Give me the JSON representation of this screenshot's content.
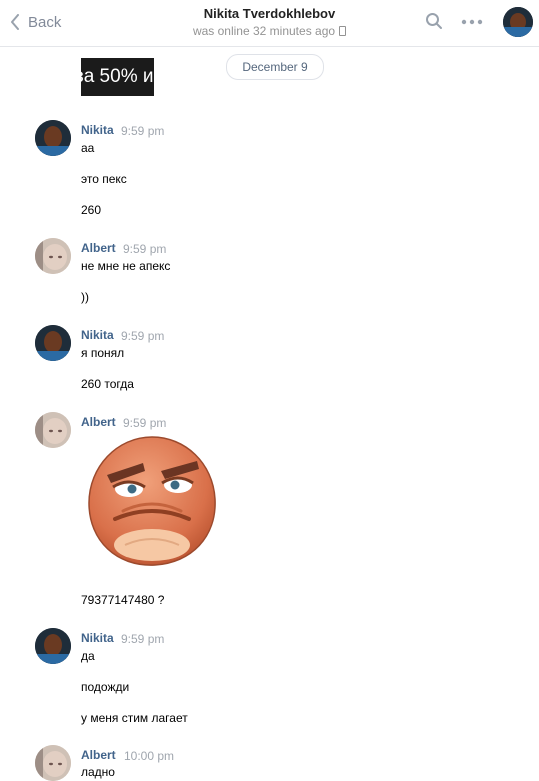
{
  "header": {
    "back_label": "Back",
    "name": "Nikita Tverdokhlebov",
    "status": "was online 32 minutes ago"
  },
  "date_divider": "December 9",
  "banner_text": "за 50% и",
  "messages": [
    {
      "author": "Nikita",
      "time": "9:59 pm",
      "lines": [
        "аа",
        "это пекс",
        "260"
      ]
    },
    {
      "author": "Albert",
      "time": "9:59 pm",
      "lines": [
        "не мне не апекс",
        "))"
      ]
    },
    {
      "author": "Nikita",
      "time": "9:59 pm",
      "lines": [
        "я понял",
        "260 тогда"
      ]
    },
    {
      "author": "Albert",
      "time": "9:59 pm",
      "lines": [
        "79377147480 ?"
      ]
    },
    {
      "author": "Nikita",
      "time": "9:59 pm",
      "lines": [
        "да",
        "подожди",
        "у меня стим лагает"
      ]
    },
    {
      "author": "Albert",
      "time": "10:00 pm",
      "lines": [
        "ладно"
      ]
    }
  ],
  "icons": {
    "back": "chevron-left-icon",
    "search": "search-icon",
    "more": "more-dots-icon",
    "sticker": "angry-face-sticker"
  },
  "colors": {
    "author": "#42648b",
    "time": "#a0a6ae",
    "accent": "#5181b8"
  }
}
